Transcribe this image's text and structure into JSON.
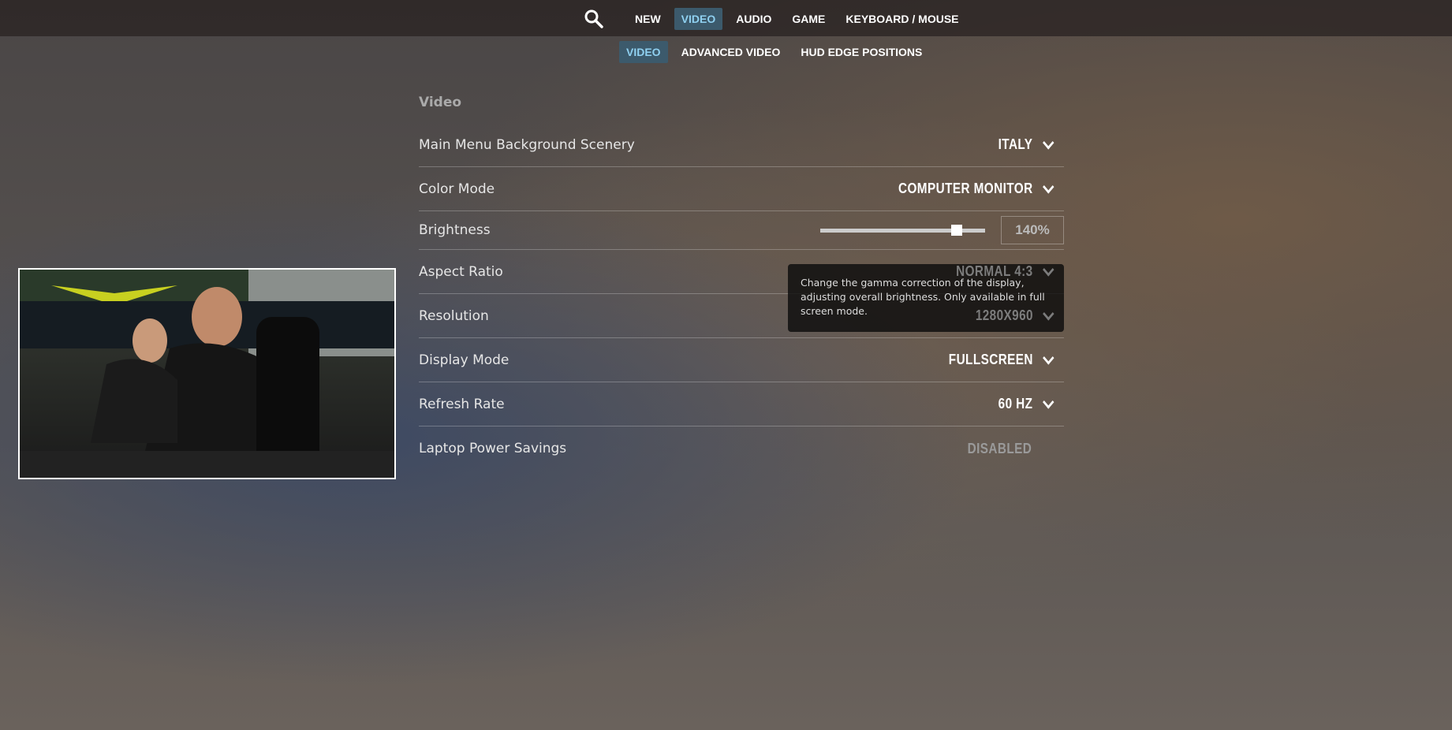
{
  "nav": {
    "tabs": [
      {
        "label": "NEW"
      },
      {
        "label": "VIDEO",
        "active": true
      },
      {
        "label": "AUDIO"
      },
      {
        "label": "GAME"
      },
      {
        "label": "KEYBOARD / MOUSE"
      }
    ],
    "search_icon": "search-icon"
  },
  "subnav": {
    "tabs": [
      {
        "label": "VIDEO",
        "active": true
      },
      {
        "label": "ADVANCED VIDEO"
      },
      {
        "label": "HUD EDGE POSITIONS"
      }
    ]
  },
  "section_title": "Video",
  "settings": [
    {
      "label": "Main Menu Background Scenery",
      "value": "ITALY"
    },
    {
      "label": "Color Mode",
      "value": "COMPUTER MONITOR"
    },
    {
      "label": "Brightness",
      "value": "140%",
      "slider_fraction": 0.85
    },
    {
      "label": "Aspect Ratio",
      "value": "NORMAL 4:3"
    },
    {
      "label": "Resolution",
      "value": "1280X960"
    },
    {
      "label": "Display Mode",
      "value": "FULLSCREEN"
    },
    {
      "label": "Refresh Rate",
      "value": "60 HZ"
    },
    {
      "label": "Laptop Power Savings",
      "value": "DISABLED"
    }
  ],
  "tooltip": "Change the gamma correction of the display, adjusting overall brightness. Only available in full screen mode.",
  "colors": {
    "active_tab_bg": "#3c5a6c",
    "active_tab_text": "#8fd0f0"
  }
}
